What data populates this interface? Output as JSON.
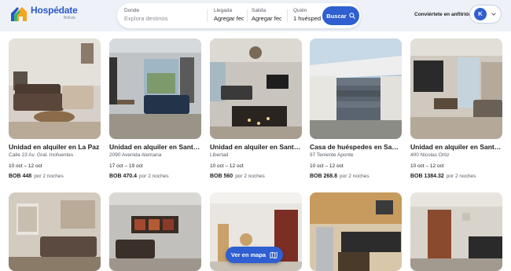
{
  "brand": {
    "name": "Hospédate",
    "tagline": "Bolivia"
  },
  "search": {
    "destination_label": "Donde",
    "destination_placeholder": "Explora destinos",
    "checkin_label": "Llegada",
    "checkin_value": "Agregar fecha",
    "checkout_label": "Salida",
    "checkout_value": "Agregar fecha",
    "guests_label": "Quién",
    "guests_value": "1 huésped",
    "button_label": "Buscar"
  },
  "header": {
    "host_link": "Conviértete en anfitrión",
    "avatar_initial": "K"
  },
  "listings": [
    {
      "title": "Unidad en alquiler en La Paz",
      "address": "Calle 23 Av. Gral. Inofuentes",
      "dates": "10 oct – 12 oct",
      "price": "BOB 448",
      "nights": "por 2 noches"
    },
    {
      "title": "Unidad en alquiler en Santa Cruz",
      "address": "2090 Avenida Alemana",
      "dates": "17 oct – 19 oct",
      "price": "BOB 470.4",
      "nights": "por 2 noches"
    },
    {
      "title": "Unidad en alquiler en Santa Cruz",
      "address": "Libertad",
      "dates": "10 oct – 12 oct",
      "price": "BOB 560",
      "nights": "por 2 noches"
    },
    {
      "title": "Casa de huéspedes en Santa Cruz",
      "address": "97 Teniente Aponte",
      "dates": "10 oct – 12 oct",
      "price": "BOB 268.8",
      "nights": "por 2 noches"
    },
    {
      "title": "Unidad en alquiler en Santa Cruz",
      "address": "400 Nicolas Ortiz",
      "dates": "10 oct – 12 oct",
      "price": "BOB 1384.32",
      "nights": "por 2 noches"
    }
  ],
  "map_button": "Ver en mapa",
  "colors": {
    "accent": "#2f5fd0",
    "header_bg": "#eef2f8"
  }
}
